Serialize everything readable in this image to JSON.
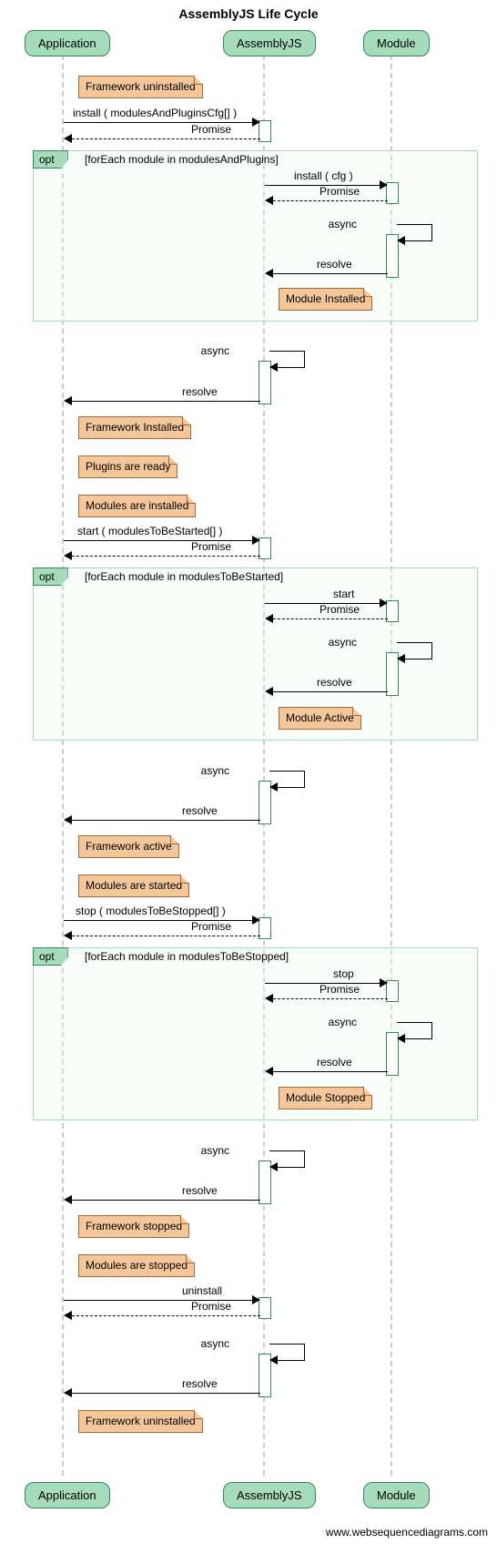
{
  "title": "AssemblyJS Life Cycle",
  "actors": {
    "application": "Application",
    "assemblyjs": "AssemblyJS",
    "module": "Module"
  },
  "notes": {
    "n1": "Framework uninstalled",
    "n2": "Module Installed",
    "n3": "Framework Installed",
    "n4": "Plugins are ready",
    "n5": "Modules are installed",
    "n6": "Module Active",
    "n7": "Framework active",
    "n8": "Modules are started",
    "n9": "Module Stopped",
    "n10": "Framework stopped",
    "n11": "Modules are stopped",
    "n12": "Framework uninstalled"
  },
  "fragments": {
    "opt_label": "opt",
    "f1_guard": "[forEach module in modulesAndPlugins]",
    "f2_guard": "[forEach module in modulesToBeStarted]",
    "f3_guard": "[forEach module in modulesToBeStopped]"
  },
  "messages": {
    "m1": "install ( modulesAndPluginsCfg[] )",
    "m2": "Promise",
    "m3": "install ( cfg )",
    "m4": "Promise",
    "m5": "async",
    "m6": "resolve",
    "m7": "async",
    "m8": "resolve",
    "m9": "start ( modulesToBeStarted[] )",
    "m10": "Promise",
    "m11": "start",
    "m12": "Promise",
    "m13": "async",
    "m14": "resolve",
    "m15": "async",
    "m16": "resolve",
    "m17": "stop ( modulesToBeStopped[] )",
    "m18": "Promise",
    "m19": "stop",
    "m20": "Promise",
    "m21": "async",
    "m22": "resolve",
    "m23": "async",
    "m24": "resolve",
    "m25": "uninstall",
    "m26": "Promise",
    "m27": "async",
    "m28": "resolve"
  },
  "footer": "www.websequencediagrams.com"
}
